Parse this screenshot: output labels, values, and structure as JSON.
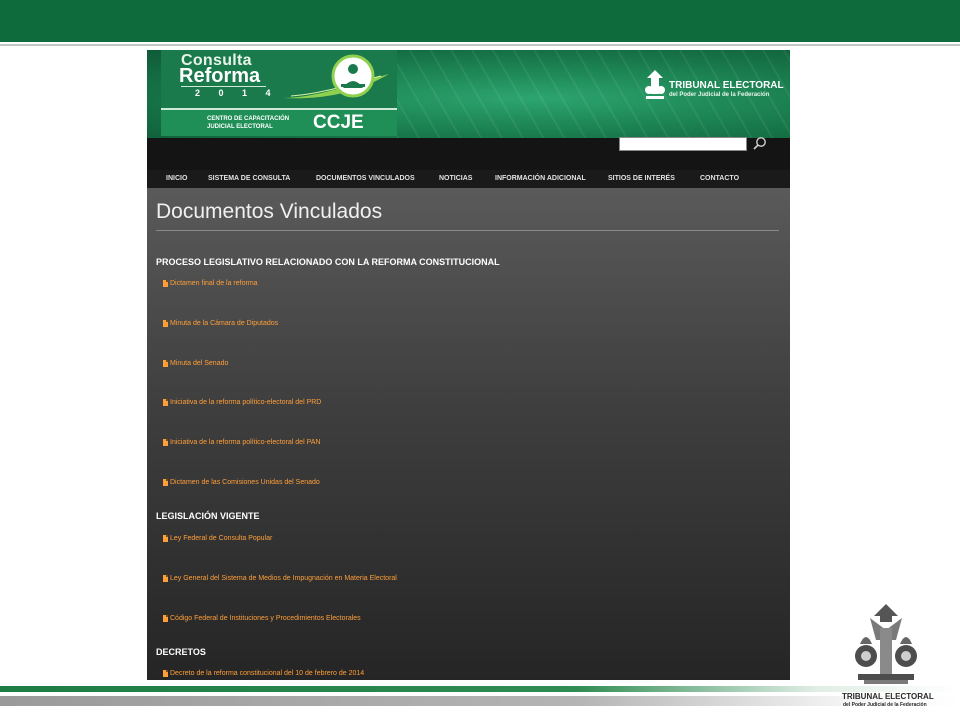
{
  "colors": {
    "slide_green": "#0e6b3c",
    "link_orange": "#ff9f3a",
    "banner_green": "#1f8a58"
  },
  "site": {
    "logo_line1": "Consulta",
    "logo_line2": "Reforma",
    "logo_year": "2 0 1 4",
    "center_name": "CENTRO DE CAPACITACIÓN\nJUDICIAL ELECTORAL",
    "center_acronym": "CCJE",
    "tribunal_name": "TRIBUNAL ELECTORAL",
    "tribunal_sub": "del Poder Judicial de la Federación",
    "emblem_icon": "seated-figure-icon",
    "tribunal_icon": "scales-emblem-icon"
  },
  "search": {
    "value": "",
    "icon": "search-icon"
  },
  "nav": [
    {
      "label": "INICIO"
    },
    {
      "label": "SISTEMA DE CONSULTA"
    },
    {
      "label": "DOCUMENTOS VINCULADOS"
    },
    {
      "label": "NOTICIAS"
    },
    {
      "label": "INFORMACIÓN ADICIONAL"
    },
    {
      "label": "SITIOS DE INTERÉS"
    },
    {
      "label": "CONTACTO"
    }
  ],
  "page": {
    "title": "Documentos Vinculados",
    "sections": [
      {
        "title": "PROCESO LEGISLATIVO RELACIONADO CON LA REFORMA CONSTITUCIONAL",
        "links": [
          "Dictamen final de la reforma",
          "Minuta de la Cámara de Diputados",
          "Minuta del Senado",
          "Iniciativa de la reforma político-electoral del PRD",
          "Iniciativa de la reforma político-electoral del PAN",
          "Dictamen de las Comisiones Unidas del Senado"
        ]
      },
      {
        "title": "LEGISLACIÓN VIGENTE",
        "links": [
          "Ley Federal de Consulta Popular",
          "Ley General del Sistema de Medios de Impugnación en Materia Electoral",
          "Código Federal de Instituciones y Procedimientos Electorales"
        ]
      },
      {
        "title": "DECRETOS",
        "links": [
          "Decreto de la reforma constitucional del 10 de febrero de 2014"
        ]
      }
    ]
  },
  "footer": {
    "name": "TRIBUNAL ELECTORAL",
    "sub": "del Poder Judicial de la Federación",
    "icon": "scales-emblem-icon"
  }
}
